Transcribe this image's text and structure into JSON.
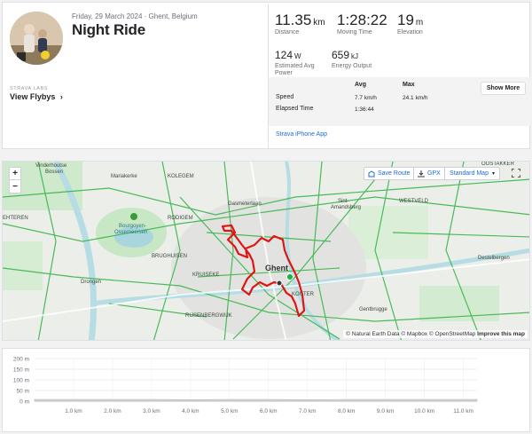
{
  "activity": {
    "date_location": "Friday, 29 March 2024 · Ghent, Belgium",
    "title": "Night Ride"
  },
  "labs": {
    "label": "STRAVA LABS",
    "flyby_label": "View Flybys",
    "flyby_chevron": "›"
  },
  "stats": {
    "distance_value": "11.35",
    "distance_unit": "km",
    "distance_label": "Distance",
    "moving_time_value": "1:28:22",
    "moving_time_label": "Moving Time",
    "elevation_value": "19",
    "elevation_unit": "m",
    "elevation_label": "Elevation",
    "power_value": "124",
    "power_unit": "W",
    "power_label": "Estimated Avg Power",
    "energy_value": "659",
    "energy_unit": "kJ",
    "energy_label": "Energy Output"
  },
  "details": {
    "col_avg": "Avg",
    "col_max": "Max",
    "speed_label": "Speed",
    "speed_avg": "7.7 km/h",
    "speed_max": "24.1 km/h",
    "elapsed_label": "Elapsed Time",
    "elapsed_avg": "1:36:44",
    "show_more": "Show More",
    "device": "Strava iPhone App"
  },
  "map": {
    "zoom_in": "+",
    "zoom_out": "−",
    "save_route": "Save Route",
    "gpx": "GPX",
    "map_style": "Standard Map",
    "fullscreen_icon": "expand-icon",
    "city": "Ghent",
    "labels": {
      "vinderhoutse": "Vinderhoutse",
      "bossen": "Bossen",
      "mariakerke": "Mariakerke",
      "kolegem": "KOLEGEM",
      "bourgoyen1": "Bourgoyen-",
      "bourgoyen2": "Ossemeersen",
      "drongen": "Drongen",
      "sint_amandsberg1": "Sint-",
      "sint_amandsberg2": "Amandsberg",
      "westveld": "WESTVELD",
      "gentbrugge": "Gentbrugge",
      "destelbergen": "Destelbergen",
      "oostakker": "OOSTAKKER",
      "rijsenberg": "RIJSENBERGWIJK",
      "brughuisen": "BRUGHUISEN",
      "gasmeter": "Gasmeterlaan",
      "kruiseke": "KRUISEKE",
      "kouter": "KOUTER",
      "ehteren": "EHTEREN",
      "rodigem": "RODIGEM"
    },
    "attribution": "© Natural Earth Data © Mapbox © OpenStreetMap",
    "improve": "Improve this map",
    "colors": {
      "route": "#e01414",
      "roads": "#39b54a",
      "water": "#b6dde4",
      "park": "#c7e7c5"
    }
  },
  "elevation_chart": {
    "type": "area",
    "ylabels": [
      "200 m",
      "150 m",
      "100 m",
      "50 m",
      "0 m"
    ],
    "yticks": [
      200,
      150,
      100,
      50,
      0
    ],
    "xlabels": [
      "1.0 km",
      "2.0 km",
      "3.0 km",
      "4.0 km",
      "5.0 km",
      "6.0 km",
      "7.0 km",
      "8.0 km",
      "9.0 km",
      "10.0 km",
      "11.0 km"
    ],
    "xticks": [
      1,
      2,
      3,
      4,
      5,
      6,
      7,
      8,
      9,
      10,
      11
    ],
    "xlim": [
      0,
      11.35
    ],
    "ylim": [
      0,
      200
    ],
    "distance_km": [
      0,
      1,
      2,
      3,
      4,
      5,
      6,
      7,
      8,
      9,
      10,
      11,
      11.35
    ],
    "elevation_m": [
      8,
      8,
      8,
      8,
      7,
      8,
      8,
      7,
      8,
      8,
      8,
      8,
      8
    ],
    "grid": true,
    "fill_color": "#d9d9d9"
  }
}
